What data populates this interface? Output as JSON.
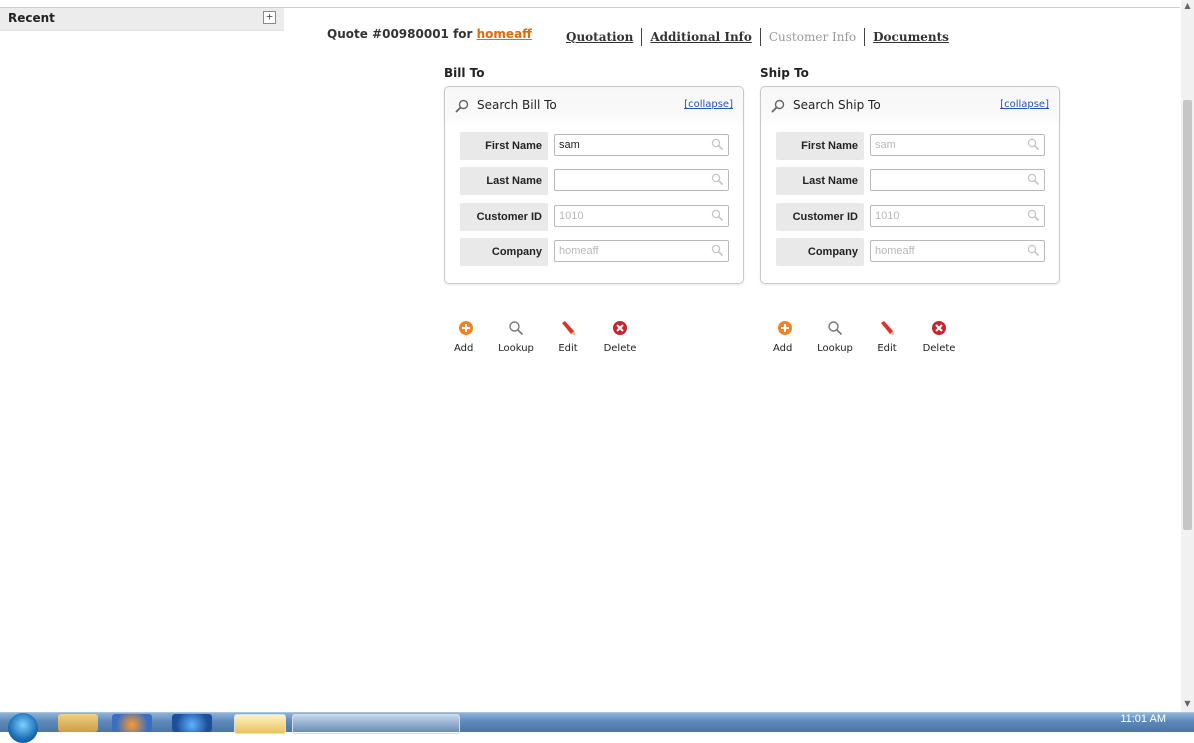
{
  "sidebar": {
    "recent_label": "Recent",
    "expand_symbol": "+"
  },
  "header": {
    "quote_prefix": "Quote #00980001 for ",
    "customer_link": "homeaff",
    "tabs": [
      {
        "label": "Quotation",
        "state": "active"
      },
      {
        "label": "Additional Info",
        "state": "active"
      },
      {
        "label": "Customer Info",
        "state": "current"
      },
      {
        "label": "Documents",
        "state": "active"
      }
    ]
  },
  "bill_to": {
    "section_title": "Bill To",
    "panel_title": "Search Bill To",
    "collapse_label": "[collapse]",
    "fields": [
      {
        "label": "First Name",
        "value": "sam",
        "placeholder": ""
      },
      {
        "label": "Last Name",
        "value": "",
        "placeholder": ""
      },
      {
        "label": "Customer ID",
        "value": "",
        "placeholder": "1010"
      },
      {
        "label": "Company",
        "value": "",
        "placeholder": "homeaff"
      }
    ],
    "actions": [
      {
        "label": "Add",
        "icon": "add-icon"
      },
      {
        "label": "Lookup",
        "icon": "lookup-icon"
      },
      {
        "label": "Edit",
        "icon": "edit-pencil-icon"
      },
      {
        "label": "Delete",
        "icon": "delete-icon"
      }
    ]
  },
  "ship_to": {
    "section_title": "Ship To",
    "panel_title": "Search Ship To",
    "collapse_label": "[collapse]",
    "fields": [
      {
        "label": "First Name",
        "value": "",
        "placeholder": "sam"
      },
      {
        "label": "Last Name",
        "value": "",
        "placeholder": ""
      },
      {
        "label": "Customer ID",
        "value": "",
        "placeholder": "1010"
      },
      {
        "label": "Company",
        "value": "",
        "placeholder": "homeaff"
      }
    ],
    "actions": [
      {
        "label": "Add",
        "icon": "add-icon"
      },
      {
        "label": "Lookup",
        "icon": "lookup-icon"
      },
      {
        "label": "Edit",
        "icon": "edit-pencil-icon"
      },
      {
        "label": "Delete",
        "icon": "delete-icon"
      }
    ]
  },
  "taskbar": {
    "clock": "11:01 AM"
  },
  "colors": {
    "link_orange": "#e06a0a",
    "collapse_blue": "#1f55b8",
    "add_orange": "#f0822a",
    "delete_red": "#c8242b"
  }
}
